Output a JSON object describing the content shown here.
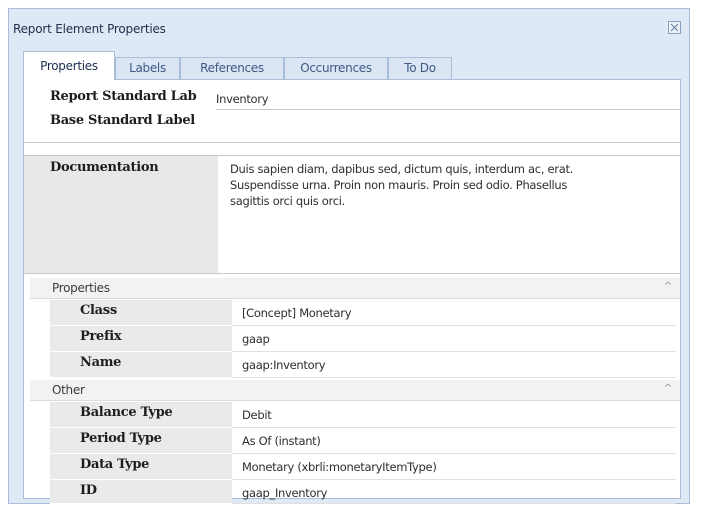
{
  "window": {
    "title": "Report Element Properties",
    "close_icon": "close-icon"
  },
  "tabs": [
    {
      "label": "Properties",
      "active": true
    },
    {
      "label": "Labels"
    },
    {
      "label": "References"
    },
    {
      "label": "Occurrences"
    },
    {
      "label": "To Do"
    }
  ],
  "top_fields": [
    {
      "label": "Report Standard Lab",
      "value": "Inventory"
    },
    {
      "label": "Base Standard Label",
      "value": ""
    }
  ],
  "documentation": {
    "label": "Documentation",
    "text_line1": "Duis sapien diam, dapibus sed, dictum quis, interdum ac, erat.",
    "text_line2": "Suspendisse urna. Proin non mauris. Proin sed odio. Phasellus",
    "text_line3": "sagittis orci quis orci."
  },
  "categories": [
    {
      "label": "Properties",
      "rows": [
        {
          "label": "Class",
          "value": "[Concept] Monetary"
        },
        {
          "label": "Prefix",
          "value": "gaap"
        },
        {
          "label": "Name",
          "value": "gaap:Inventory"
        }
      ]
    },
    {
      "label": "Other",
      "rows": [
        {
          "label": "Balance Type",
          "value": "Debit"
        },
        {
          "label": "Period Type",
          "value": "As Of (instant)"
        },
        {
          "label": "Data Type",
          "value": "Monetary (xbrli:monetaryItemType)"
        },
        {
          "label": "ID",
          "value": "gaap_Inventory"
        }
      ]
    }
  ],
  "colors": {
    "window_bg": "#dfe8f5",
    "border": "#a9bdd8",
    "label_bg": "#eaeaea"
  }
}
